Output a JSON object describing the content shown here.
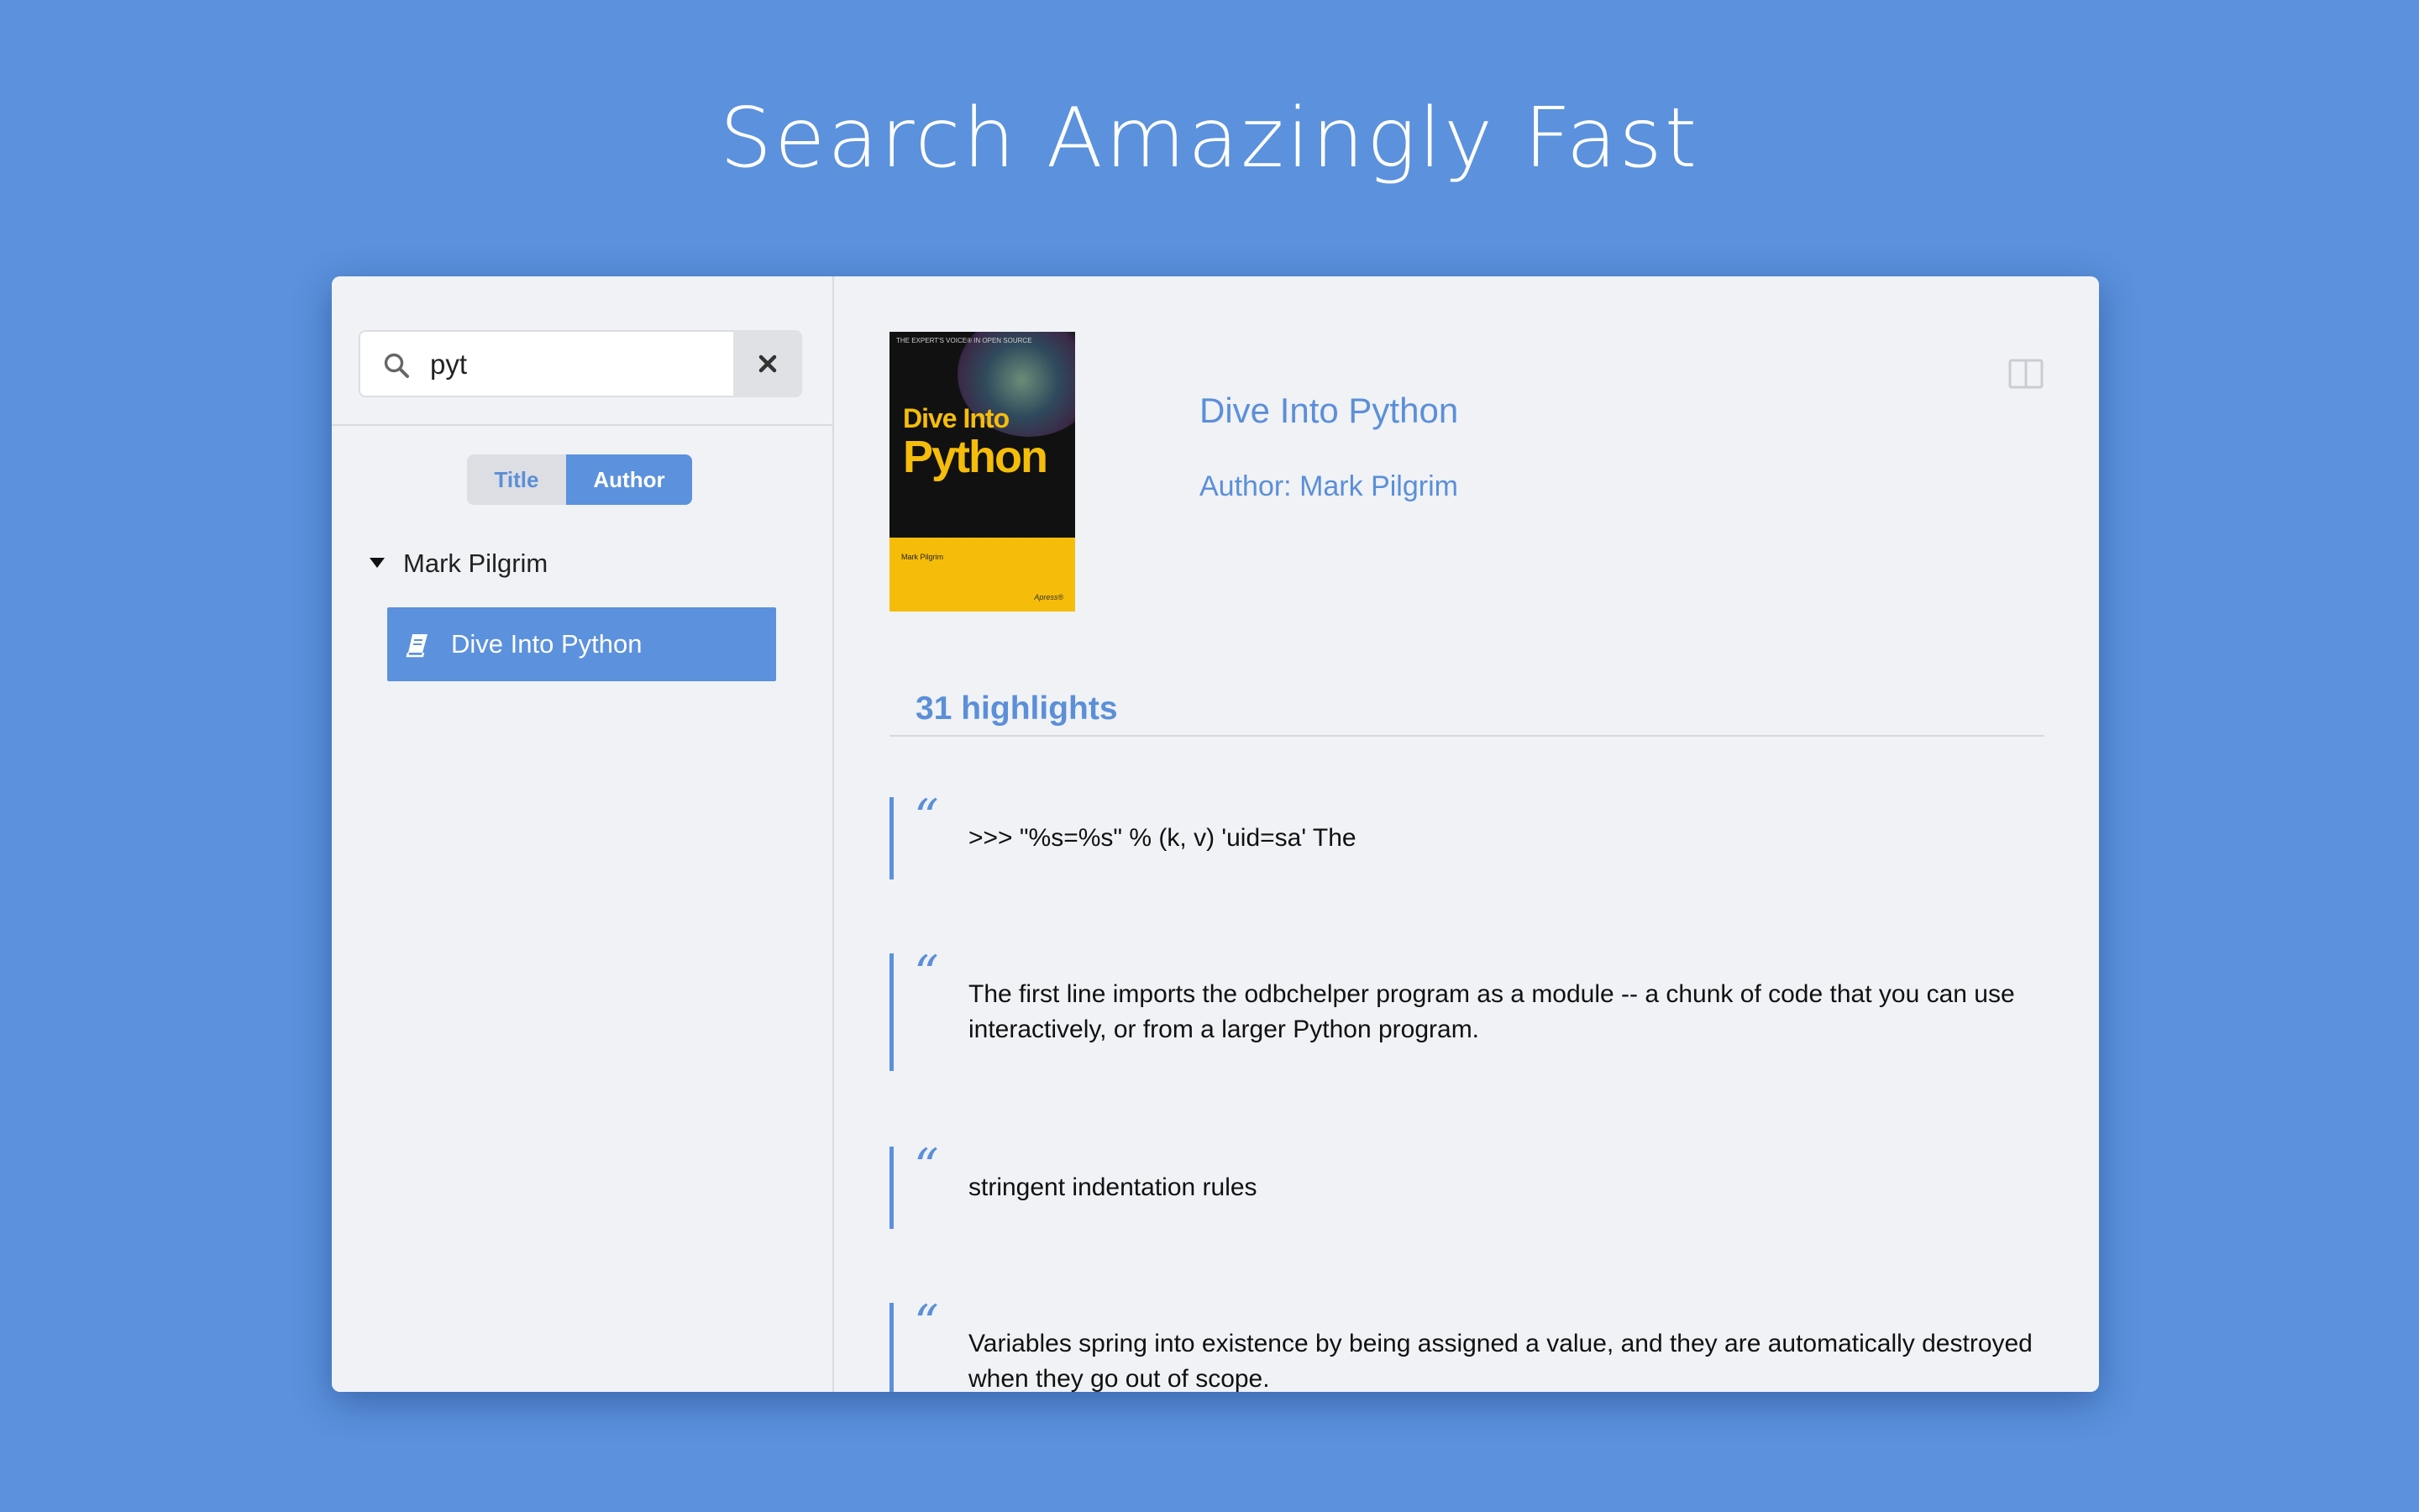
{
  "headline": "Search Amazingly Fast",
  "search": {
    "value": "pyt"
  },
  "filter": {
    "title_label": "Title",
    "author_label": "Author",
    "selected": "Author"
  },
  "tree": {
    "author": "Mark Pilgrim",
    "books": [
      {
        "label": "Dive Into Python",
        "selected": true
      }
    ]
  },
  "detail": {
    "cover": {
      "top_line": "THE EXPERT'S VOICE® IN OPEN SOURCE",
      "title_line1": "Dive Into",
      "title_line2": "Python",
      "author": "Mark Pilgrim",
      "publisher": "Apress®"
    },
    "title": "Dive Into Python",
    "author": "Author: Mark Pilgrim",
    "highlights_count": "31 highlights",
    "highlights": [
      {
        "text": ">>> \"%s=%s\" % (k, v) 'uid=sa' The"
      },
      {
        "text": "The first line imports the odbchelper program as a module -- a chunk of code that you can use interactively, or from a larger Python program."
      },
      {
        "text": "stringent indentation rules"
      },
      {
        "text": "Variables spring into existence by being assigned a value, and they are automatically destroyed when they go out of scope."
      }
    ]
  },
  "colors": {
    "background": "#5b91dd",
    "accent": "#5b8fd8",
    "window": "#f0f2f6"
  },
  "icons": [
    "search-icon",
    "clear-icon",
    "disclosure-triangle-icon",
    "book-icon",
    "panel-toggle-icon",
    "quote-icon"
  ]
}
